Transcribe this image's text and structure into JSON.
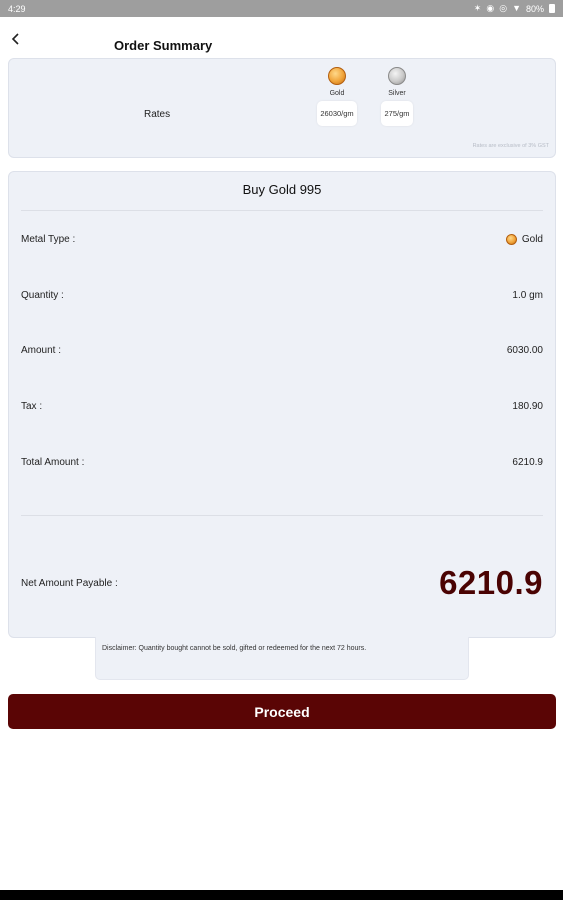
{
  "status_bar": {
    "time": "4:29",
    "battery": "80%",
    "icons": [
      "bluetooth-icon",
      "eye-icon",
      "circle-icon",
      "wifi-icon",
      "battery-icon"
    ]
  },
  "header": {
    "title": "Order Summary",
    "back_icon": "chevron-left-icon"
  },
  "rates": {
    "label": "Rates",
    "gold": {
      "name": "Gold",
      "rate": "26030/gm"
    },
    "silver": {
      "name": "Silver",
      "rate": "275/gm"
    },
    "note": "Rates are exclusive of 3% GST"
  },
  "summary": {
    "title": "Buy Gold 995",
    "rows": [
      {
        "label": "Metal Type :",
        "value": "Gold"
      },
      {
        "label": "Quantity :",
        "value": "1.0 gm"
      },
      {
        "label": "Amount :",
        "value": "6030.00"
      },
      {
        "label": "Tax :",
        "value": "180.90"
      },
      {
        "label": "Total Amount :",
        "value": "6210.9"
      }
    ],
    "net_label": "Net Amount Payable :",
    "net_value": "6210.9"
  },
  "disclaimer": "Disclaimer: Quantity bought cannot be sold, gifted or redeemed for the next 72 hours.",
  "proceed_label": "Proceed",
  "colors": {
    "accent": "#5a0505",
    "card_bg": "#eef1f7",
    "net_value": "#4a0303"
  }
}
